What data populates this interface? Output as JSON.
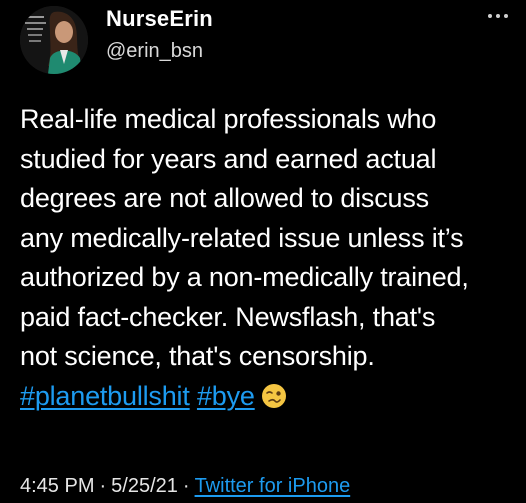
{
  "author": {
    "display_name": "NurseErin",
    "handle": "@erin_bsn"
  },
  "tweet": {
    "lines": [
      "Real-life medical professionals who",
      "studied for years and earned actual",
      "degrees are not allowed to discuss",
      "any medically-related issue unless it’s",
      "authorized by a non-medically trained,",
      "paid fact-checker. Newsflash, that's",
      "not science, that's censorship."
    ],
    "hashtags": [
      "#planetbullshit",
      "#bye"
    ],
    "emoji_icon": "woozy-face-icon"
  },
  "meta": {
    "time": "4:45 PM",
    "separator": "·",
    "date": "5/25/21",
    "source": "Twitter for iPhone"
  },
  "colors": {
    "background": "#000000",
    "text": "#ffffff",
    "link": "#1d9bf0"
  }
}
